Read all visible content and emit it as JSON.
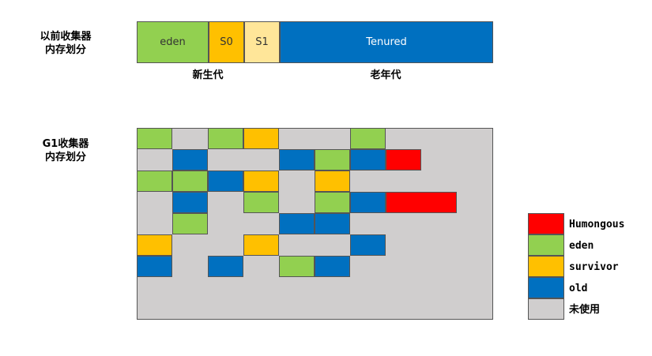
{
  "old_layout": {
    "title": "以前收集器\n内存划分",
    "segments": [
      {
        "label": "eden",
        "color": "#92d050",
        "text_color": "#333333"
      },
      {
        "label": "S0",
        "color": "#ffc000",
        "text_color": "#333333"
      },
      {
        "label": "S1",
        "color": "#ffe699",
        "text_color": "#333333"
      },
      {
        "label": "Tenured",
        "color": "#0070c0",
        "text_color": "#ffffff"
      }
    ],
    "young_label": "新生代",
    "old_label": "老年代"
  },
  "g1_layout": {
    "title": "G1收集器\n内存划分",
    "background_color": "#d0cece",
    "regions": [
      {
        "type": "eden",
        "row": 0,
        "col": 0
      },
      {
        "type": "eden",
        "row": 0,
        "col": 2
      },
      {
        "type": "survivor",
        "row": 0,
        "col": 3
      },
      {
        "type": "eden",
        "row": 0,
        "col": 6
      },
      {
        "type": "old",
        "row": 1,
        "col": 1
      },
      {
        "type": "old",
        "row": 1,
        "col": 4
      },
      {
        "type": "eden",
        "row": 1,
        "col": 5
      },
      {
        "type": "old",
        "row": 1,
        "col": 6
      },
      {
        "type": "humongous",
        "row": 1,
        "col": 7,
        "span": 1
      },
      {
        "type": "eden",
        "row": 2,
        "col": 0
      },
      {
        "type": "eden",
        "row": 2,
        "col": 1
      },
      {
        "type": "old",
        "row": 2,
        "col": 2
      },
      {
        "type": "survivor",
        "row": 2,
        "col": 3
      },
      {
        "type": "survivor",
        "row": 2,
        "col": 5
      },
      {
        "type": "old",
        "row": 3,
        "col": 1
      },
      {
        "type": "eden",
        "row": 3,
        "col": 3
      },
      {
        "type": "eden",
        "row": 3,
        "col": 5
      },
      {
        "type": "old",
        "row": 3,
        "col": 6
      },
      {
        "type": "humongous",
        "row": 3,
        "col": 7,
        "span": 2
      },
      {
        "type": "eden",
        "row": 4,
        "col": 1
      },
      {
        "type": "old",
        "row": 4,
        "col": 4
      },
      {
        "type": "old",
        "row": 4,
        "col": 5
      },
      {
        "type": "survivor",
        "row": 5,
        "col": 0
      },
      {
        "type": "survivor",
        "row": 5,
        "col": 3
      },
      {
        "type": "old",
        "row": 5,
        "col": 6
      },
      {
        "type": "old",
        "row": 6,
        "col": 0
      },
      {
        "type": "old",
        "row": 6,
        "col": 2
      },
      {
        "type": "eden",
        "row": 6,
        "col": 4
      },
      {
        "type": "old",
        "row": 6,
        "col": 5
      }
    ]
  },
  "legend": [
    {
      "type": "humongous",
      "label": "Humongous",
      "color": "#ff0000"
    },
    {
      "type": "eden",
      "label": "eden",
      "color": "#92d050"
    },
    {
      "type": "survivor",
      "label": "survivor",
      "color": "#ffc000"
    },
    {
      "type": "old",
      "label": "old",
      "color": "#0070c0"
    },
    {
      "type": "unused",
      "label": "未使用",
      "color": "#d0cece"
    }
  ]
}
